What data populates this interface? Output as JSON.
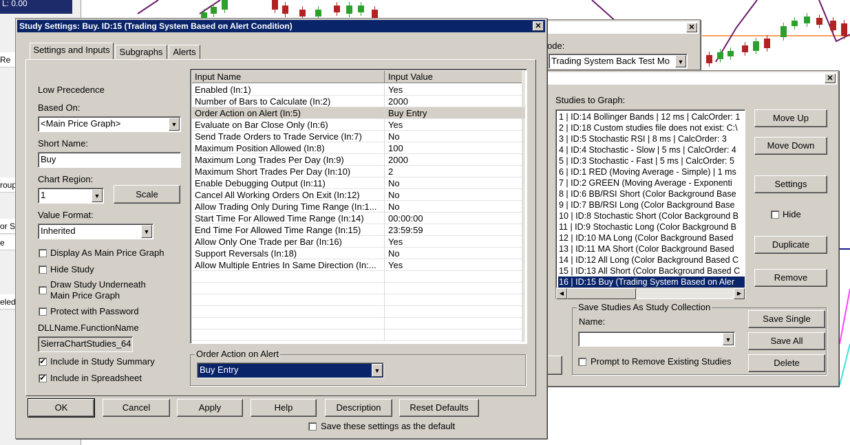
{
  "chart_info": {
    "low_label": "L: 0.00"
  },
  "left_strip_labels": [
    "Re",
    "roup",
    "or St",
    "e",
    "eled"
  ],
  "back_dialog_small": {
    "mode_label": "ode:",
    "mode_value": "Trading System Back Test Mo"
  },
  "studies_dialog": {
    "studies_label": "Studies to Graph:",
    "studies": [
      "1 | ID:14  Bollinger Bands | 12 ms | CalcOrder: 1",
      "2 | ID:18  Custom studies file does not exist: C:\\",
      "3 | ID:5  Stochastic RSI | 8 ms | CalcOrder: 3",
      "4 | ID:4  Stochastic - Slow | 5 ms | CalcOrder: 4",
      "5 | ID:3  Stochastic - Fast | 5 ms | CalcOrder: 5",
      "6 | ID:1  RED (Moving Average - Simple) | 1 ms",
      "7 | ID:2  GREEN (Moving Average - Exponenti",
      "8 | ID:6  BB/RSI Short (Color Background Base",
      "9 | ID:7  BB/RSI Long (Color Background Base",
      "10 | ID:8  Stochastic Short (Color Background B",
      "11 | ID:9  Stochastic Long (Color Background B",
      "12 | ID:10  MA Long (Color Background Based",
      "13 | ID:11  MA Short (Color Background Based",
      "14 | ID:12  All Long (Color Background Based C",
      "15 | ID:13  All Short (Color Background Based C",
      "16 | ID:15  Buy (Trading System Based on Aler"
    ],
    "selected_index": 15,
    "buttons": {
      "move_up": "Move Up",
      "move_down": "Move Down",
      "settings": "Settings",
      "hide": "Hide",
      "duplicate": "Duplicate",
      "remove": "Remove",
      "save_single": "Save Single",
      "save_all": "Save All",
      "delete": "Delete"
    },
    "collection_group_title": "Save Studies As Study Collection",
    "name_label": "Name:",
    "name_value": "",
    "prompt_remove_label": "Prompt to Remove Existing Studies"
  },
  "study_settings": {
    "title": "Study Settings: Buy. ID:15 (Trading System Based on Alert Condition)",
    "tabs": [
      "Settings and Inputs",
      "Subgraphs",
      "Alerts"
    ],
    "active_tab": 0,
    "low_precedence": "Low Precedence",
    "based_on_label": "Based On:",
    "based_on_value": "<Main Price Graph>",
    "short_name_label": "Short Name:",
    "short_name_value": "Buy",
    "chart_region_label": "Chart Region:",
    "chart_region_value": "1",
    "scale_button": "Scale",
    "value_format_label": "Value Format:",
    "value_format_value": "Inherited",
    "checkboxes": {
      "display_main": {
        "label": "Display As Main Price Graph",
        "checked": false
      },
      "hide_study": {
        "label": "Hide Study",
        "checked": false
      },
      "draw_underneath_1": "Draw Study Underneath",
      "draw_underneath_2": "Main Price Graph",
      "draw_underneath_checked": false,
      "protect": {
        "label": "Protect with Password",
        "checked": false
      },
      "include_summary": {
        "label": "Include in Study Summary",
        "checked": true
      },
      "include_spreadsheet": {
        "label": "Include in Spreadsheet",
        "checked": true
      }
    },
    "dll_label": "DLLName.FunctionName",
    "dll_value": "SierraChartStudies_64",
    "grid": {
      "headers": [
        "Input Name",
        "Input Value"
      ],
      "rows": [
        [
          "Enabled   (In:1)",
          "Yes"
        ],
        [
          "Number of Bars to Calculate   (In:2)",
          "2000"
        ],
        [
          "Order Action on Alert   (In:5)",
          "Buy Entry"
        ],
        [
          "Evaluate on Bar Close Only   (In:6)",
          "Yes"
        ],
        [
          "Send Trade Orders to Trade Service   (In:7)",
          "No"
        ],
        [
          "Maximum Position Allowed   (In:8)",
          "100"
        ],
        [
          "Maximum Long Trades Per Day   (In:9)",
          "2000"
        ],
        [
          "Maximum Short Trades Per Day   (In:10)",
          "2"
        ],
        [
          "Enable Debugging Output   (In:11)",
          "No"
        ],
        [
          "Cancel All Working Orders On Exit   (In:12)",
          "No"
        ],
        [
          "Allow Trading Only During Time Range   (In:1...",
          "No"
        ],
        [
          "Start Time For Allowed Time Range   (In:14)",
          "00:00:00"
        ],
        [
          "End Time For Allowed Time Range   (In:15)",
          "23:59:59"
        ],
        [
          "Allow Only One Trade per Bar   (In:16)",
          "Yes"
        ],
        [
          "Support Reversals   (In:18)",
          "No"
        ],
        [
          "Allow Multiple Entries In Same Direction   (In:...",
          "Yes"
        ]
      ],
      "selected_row": 2,
      "empty_rows": 6
    },
    "edit_group_title": "Order Action on Alert",
    "edit_group_value": "Buy Entry",
    "buttons": {
      "ok": "OK",
      "cancel": "Cancel",
      "apply": "Apply",
      "help": "Help",
      "description": "Description",
      "reset_defaults": "Reset Defaults"
    },
    "save_default_label": "Save these settings as the default",
    "save_default_checked": false
  }
}
